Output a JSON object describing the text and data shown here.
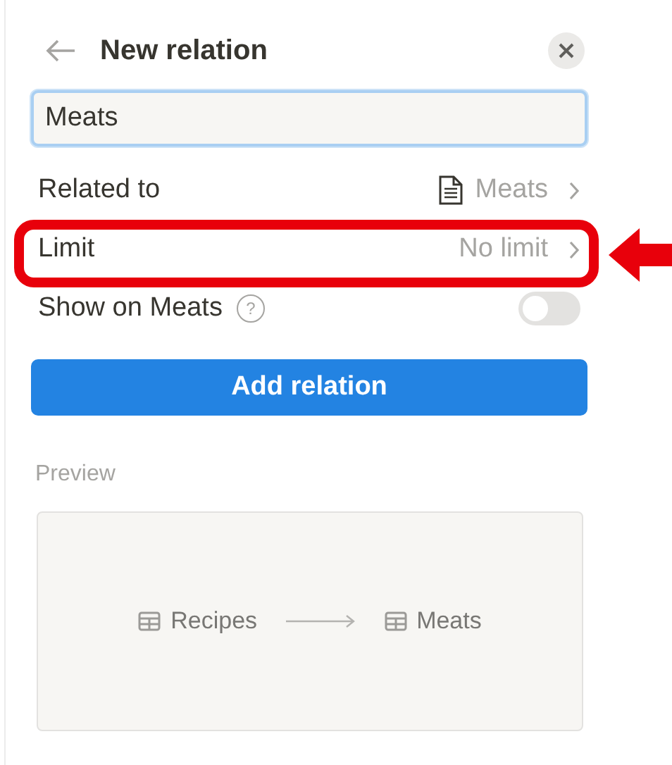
{
  "header": {
    "title": "New relation"
  },
  "name_field": {
    "value": "Meats"
  },
  "rows": [
    {
      "kind": "link",
      "label": "Related to",
      "value": "Meats",
      "page_icon": true,
      "highlighted": false
    },
    {
      "kind": "link",
      "label": "Limit",
      "value": "No limit",
      "page_icon": false,
      "highlighted": true
    },
    {
      "kind": "toggle",
      "label": "Show on Meats",
      "help": "?",
      "on": false
    }
  ],
  "add_button": {
    "label": "Add relation"
  },
  "preview": {
    "label": "Preview",
    "source": "Recipes",
    "target": "Meats"
  }
}
